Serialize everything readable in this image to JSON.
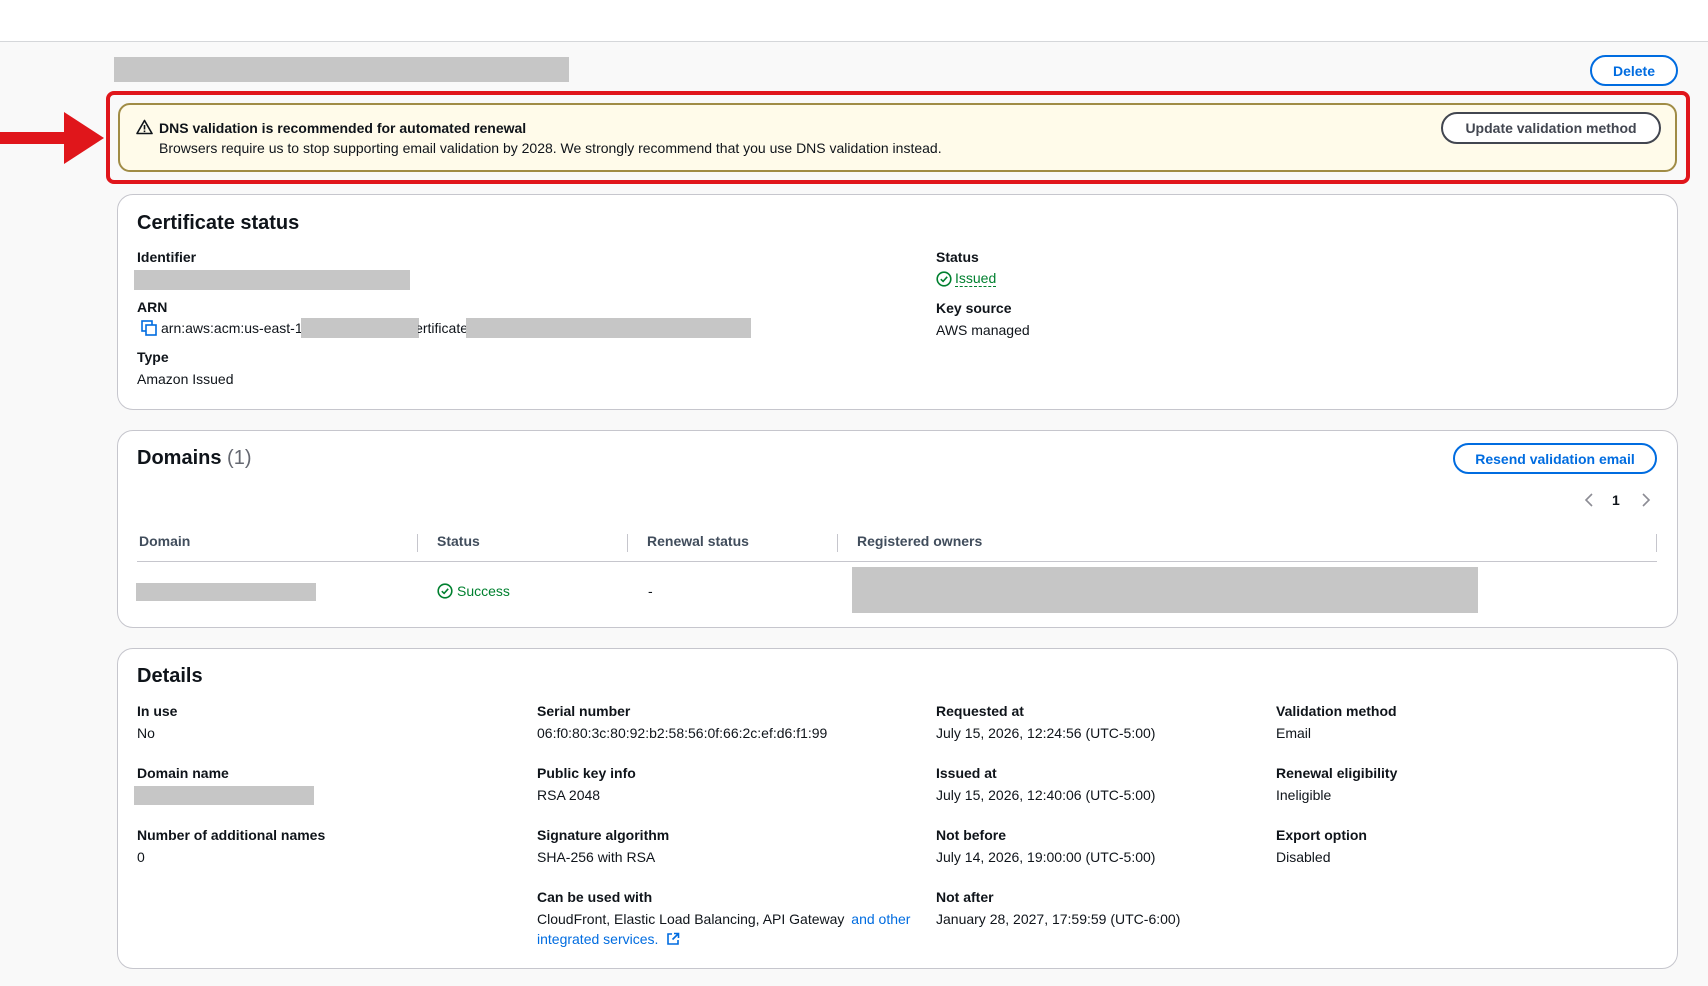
{
  "header": {
    "delete_label": "Delete"
  },
  "alert": {
    "title": "DNS validation is recommended for automated renewal",
    "message": "Browsers require us to stop supporting email validation by 2028. We strongly recommend that you use DNS validation instead.",
    "button_label": "Update validation method"
  },
  "certificate_status": {
    "title": "Certificate status",
    "identifier_label": "Identifier",
    "arn_label": "ARN",
    "arn_prefix": "arn:aws:acm:us-east-1",
    "arn_middle": "certificate",
    "type_label": "Type",
    "type_value": "Amazon Issued",
    "status_label": "Status",
    "status_value": "Issued",
    "key_source_label": "Key source",
    "key_source_value": "AWS managed"
  },
  "domains": {
    "title": "Domains",
    "count": "(1)",
    "resend_label": "Resend validation email",
    "page": "1",
    "columns": [
      "Domain",
      "Status",
      "Renewal status",
      "Registered owners"
    ],
    "rows": [
      {
        "status": "Success",
        "renewal_status": "-"
      }
    ]
  },
  "details": {
    "title": "Details",
    "in_use_label": "In use",
    "in_use_value": "No",
    "domain_name_label": "Domain name",
    "additional_names_label": "Number of additional names",
    "additional_names_value": "0",
    "serial_label": "Serial number",
    "serial_value": "06:f0:80:3c:80:92:b2:58:56:0f:66:2c:ef:d6:f1:99",
    "public_key_label": "Public key info",
    "public_key_value": "RSA 2048",
    "signature_label": "Signature algorithm",
    "signature_value": "SHA-256 with RSA",
    "can_be_used_label": "Can be used with",
    "can_be_used_value": "CloudFront, Elastic Load Balancing, API Gateway",
    "can_be_used_link_1": "and other",
    "can_be_used_link_2": "integrated services.",
    "requested_label": "Requested at",
    "requested_value": "July 15, 2026, 12:24:56 (UTC-5:00)",
    "issued_label": "Issued at",
    "issued_value": "July 15, 2026, 12:40:06 (UTC-5:00)",
    "not_before_label": "Not before",
    "not_before_value": "July 14, 2026, 19:00:00 (UTC-5:00)",
    "not_after_label": "Not after",
    "not_after_value": "January 28, 2027, 17:59:59 (UTC-6:00)",
    "validation_label": "Validation method",
    "validation_value": "Email",
    "renewal_label": "Renewal eligibility",
    "renewal_value": "Ineligible",
    "export_label": "Export option",
    "export_value": "Disabled"
  },
  "colors": {
    "accent": "#006ce0",
    "success": "#00802f",
    "warning_bg": "#fffbea",
    "annotation": "#e0161b"
  }
}
